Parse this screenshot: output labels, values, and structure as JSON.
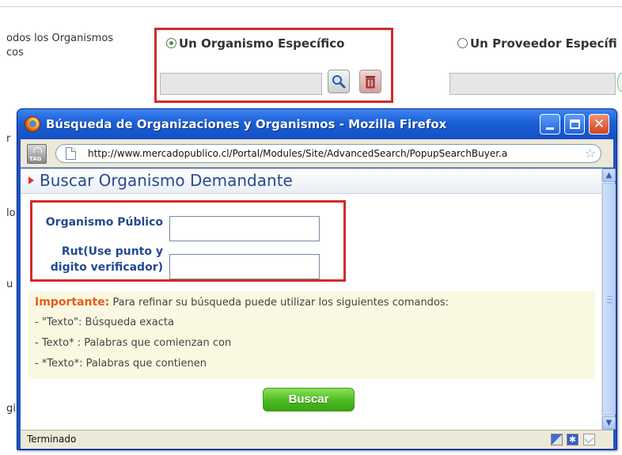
{
  "background": {
    "left_text_lines": [
      "odos los Organismos",
      "cos"
    ],
    "option_specific_org": "Un Organismo Específico",
    "option_specific_provider": "Un Proveedor Específi",
    "side_fragments": [
      "r",
      "lo",
      "u",
      "gi"
    ],
    "bottom_text": "_____ ________ ____ ________ _ _ _____ ___ _____"
  },
  "window": {
    "title": "Búsqueda de Organizaciones y Organismos - Mozilla Firefox",
    "tag_label": "TAG",
    "url": "http://www.mercadopublico.cl/Portal/Modules/Site/AdvancedSearch/PopupSearchBuyer.a",
    "status": "Terminado"
  },
  "popup": {
    "heading": "Buscar Organismo Demandante",
    "fields": {
      "org_label": "Organismo Público",
      "org_value": "",
      "rut_label_line1": "Rut(Use punto y",
      "rut_label_line2": "digito verificador)",
      "rut_value": ""
    },
    "note": {
      "important_label": "Importante:",
      "intro": " Para refinar su búsqueda puede utilizar los siguientes comandos:",
      "lines": [
        "- \"Texto\": Búsqueda exacta",
        "- Texto* : Palabras que comienzan con",
        "- *Texto*: Palabras que contienen"
      ]
    },
    "search_button": "Buscar"
  },
  "icons": {
    "app": "firefox-icon",
    "minimize": "minimize-icon",
    "maximize": "maximize-icon",
    "close": "close-icon",
    "bookmark": "star-icon",
    "page": "page-icon"
  },
  "colors": {
    "titlebar": "#1b5fd6",
    "highlight_box": "#d22a2a",
    "label_blue": "#244a8f",
    "important": "#e55c1a",
    "button_green": "#4cbb22",
    "note_bg": "#fbf8e1"
  }
}
